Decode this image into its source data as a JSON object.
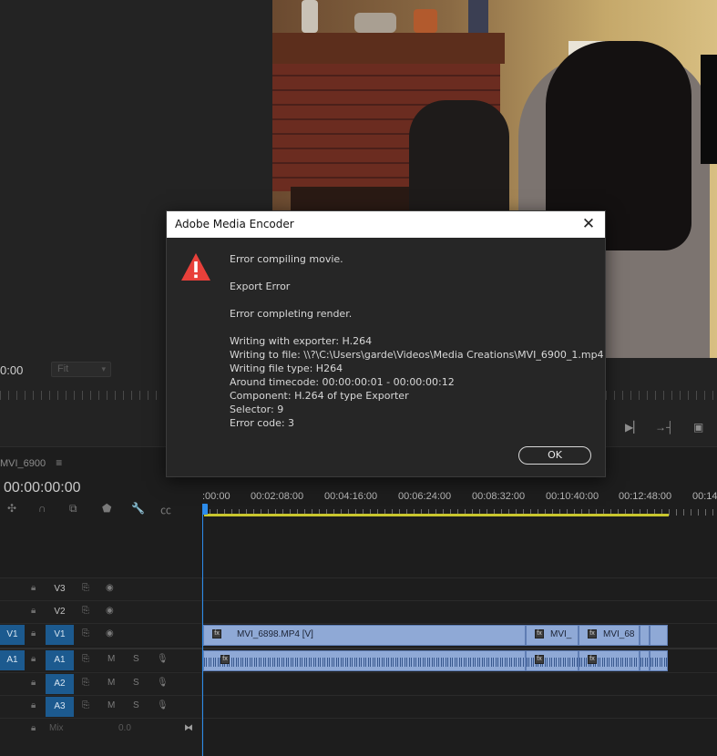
{
  "monitor": {
    "timecode": "0:00",
    "zoom_select": "Fit"
  },
  "sequence": {
    "tab_label": "MVI_6900",
    "menu_icon": "≡",
    "timecode": "00:00:00:00",
    "ruler_labels": [
      ":00:00",
      "00:02:08:00",
      "00:04:16:00",
      "00:06:24:00",
      "00:08:32:00",
      "00:10:40:00",
      "00:12:48:00",
      "00:14"
    ]
  },
  "tracks": {
    "v3": {
      "target": "V3"
    },
    "v2": {
      "target": "V2"
    },
    "v1": {
      "source": "V1",
      "target": "V1"
    },
    "a1": {
      "source": "A1",
      "target": "A1",
      "mute": "M",
      "solo": "S"
    },
    "a2": {
      "target": "A2",
      "mute": "M",
      "solo": "S"
    },
    "a3": {
      "target": "A3",
      "mute": "M",
      "solo": "S"
    },
    "mix": {
      "label": "Mix",
      "value": "0.0"
    }
  },
  "clips": {
    "v1": [
      "MVI_6898.MP4 [V]",
      "MVI_",
      "MVI_68"
    ]
  },
  "dialog": {
    "title": "Adobe Media Encoder",
    "close_glyph": "✕",
    "line1": "Error compiling movie.",
    "line2": "Export Error",
    "line3": "Error completing render.",
    "details": [
      "Writing with exporter: H.264",
      "Writing to file: \\\\?\\C:\\Users\\garde\\Videos\\Media Creations\\MVI_6900_1.mp4",
      "Writing file type: H264",
      "Around timecode: 00:00:00:01 - 00:00:00:12",
      "Component: H.264 of type Exporter",
      "Selector: 9",
      "Error code: 3"
    ],
    "ok_label": "OK"
  },
  "colors": {
    "warning": "#e8403a",
    "track_target": "#1c5a8f",
    "clip": "#8fa9d6",
    "playhead": "#2d8ceb",
    "work_area": "#c9c62e"
  }
}
